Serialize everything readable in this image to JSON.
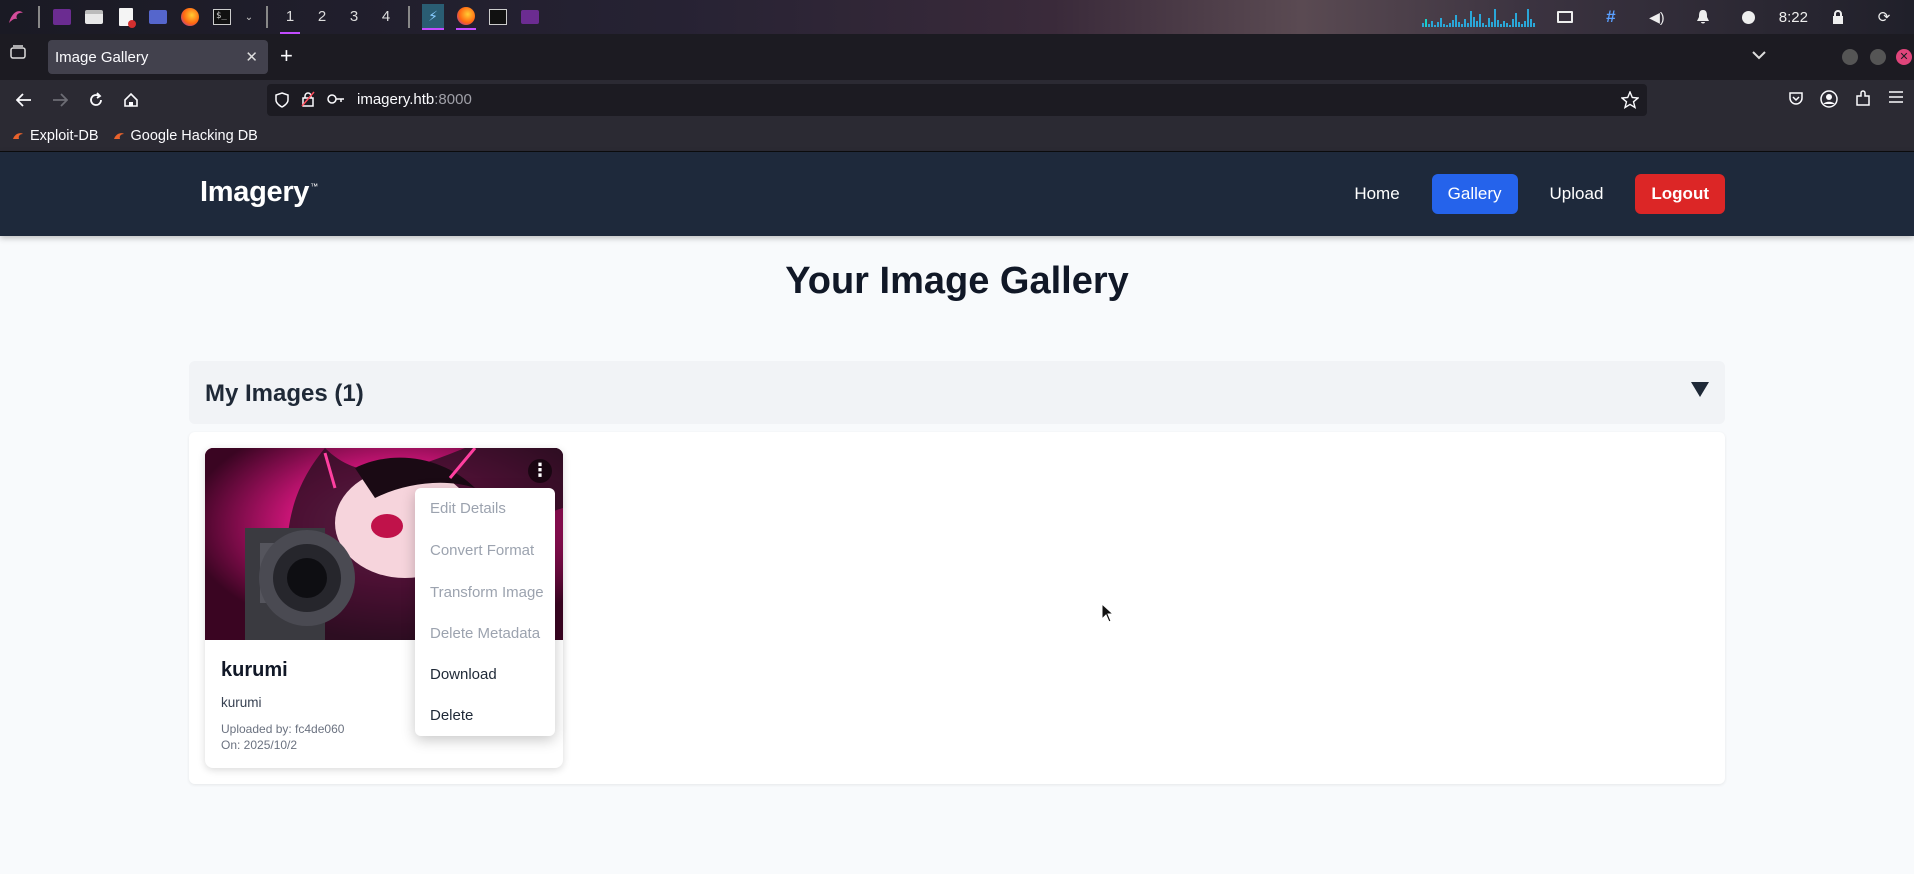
{
  "taskbar": {
    "workspaces": [
      "1",
      "2",
      "3",
      "4"
    ],
    "clock": "8:22"
  },
  "browser": {
    "tab_title": "Image Gallery",
    "url_host": "imagery.htb",
    "url_port": ":8000",
    "bookmarks": [
      "Exploit-DB",
      "Google Hacking DB"
    ]
  },
  "site": {
    "brand": "Imagery",
    "brand_mark": "™",
    "nav": {
      "home": "Home",
      "gallery": "Gallery",
      "upload": "Upload",
      "logout": "Logout"
    },
    "page_title": "Your Image Gallery",
    "section_title": "My Images (1)"
  },
  "card": {
    "title": "kurumi",
    "description": "kurumi",
    "uploaded_by": "Uploaded by: fc4de060",
    "uploaded_on": "On: 2025/10/2",
    "kebab": "⋮"
  },
  "menu": {
    "items": [
      {
        "label": "Edit Details",
        "enabled": false
      },
      {
        "label": "Convert Format",
        "enabled": false
      },
      {
        "label": "Transform Image",
        "enabled": false
      },
      {
        "label": "Delete Metadata",
        "enabled": false
      },
      {
        "label": "Download",
        "enabled": true
      },
      {
        "label": "Delete",
        "enabled": true
      }
    ]
  },
  "colors": {
    "header_bg": "#1e293b",
    "accent_blue": "#2563eb",
    "logout_red": "#dc2626"
  }
}
